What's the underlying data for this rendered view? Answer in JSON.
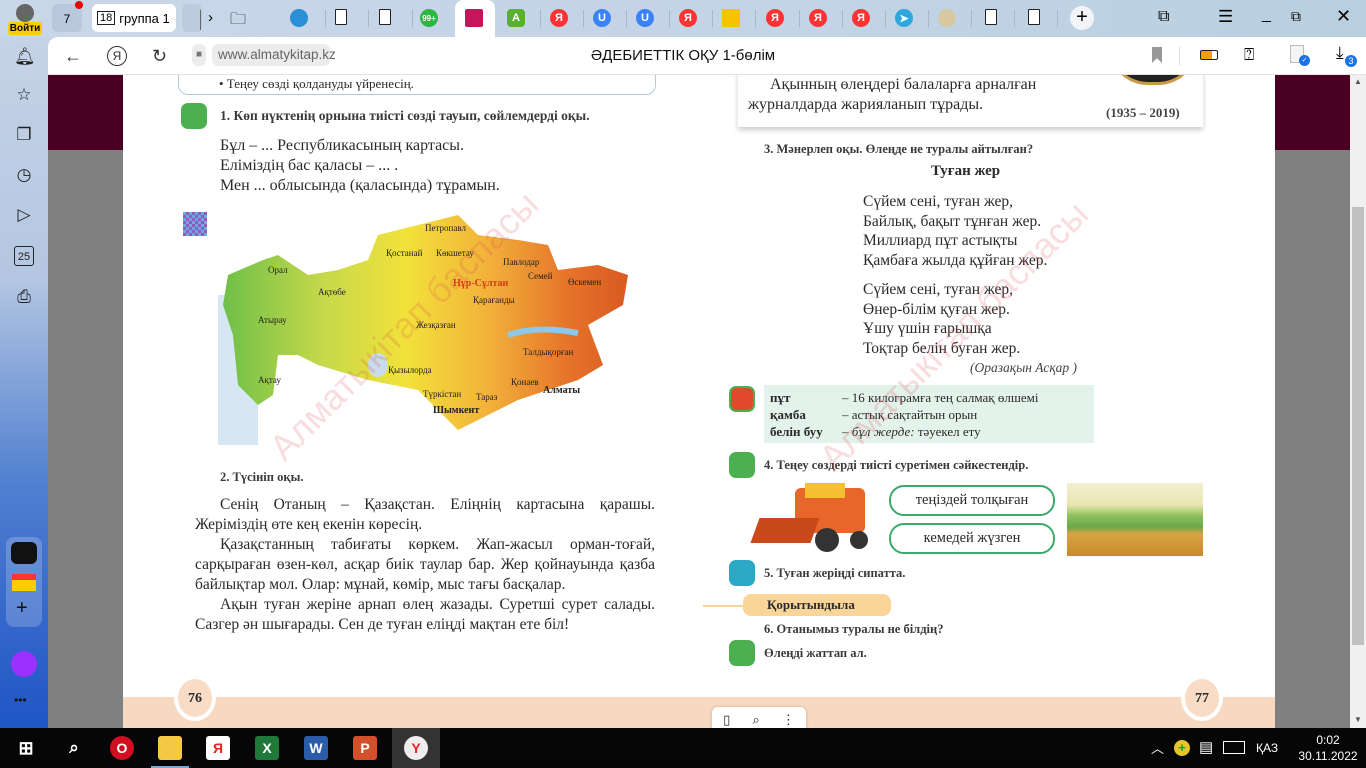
{
  "browser": {
    "profile_label": "Войти",
    "home_count": "7",
    "tab_group": {
      "count": "18",
      "label": "группа 1"
    },
    "whatsapp_badge": "99+",
    "tabs": [
      {
        "icon": "globe-icon"
      },
      {
        "icon": "document-icon"
      },
      {
        "icon": "document-icon"
      },
      {
        "icon": "whatsapp-icon"
      },
      {
        "icon": "book-icon",
        "active": true
      },
      {
        "icon": "green-a-icon",
        "letter": "A"
      },
      {
        "icon": "yandex-icon",
        "letter": "Я"
      },
      {
        "icon": "u-icon",
        "letter": "U"
      },
      {
        "icon": "u-icon",
        "letter": "U"
      },
      {
        "icon": "yandex-icon",
        "letter": "Я"
      },
      {
        "icon": "image-icon"
      },
      {
        "icon": "yandex-icon",
        "letter": "Я"
      },
      {
        "icon": "yandex-icon",
        "letter": "Я"
      },
      {
        "icon": "yandex-icon",
        "letter": "Я"
      },
      {
        "icon": "telegram-icon"
      },
      {
        "icon": "emblem-icon"
      },
      {
        "icon": "document-icon"
      },
      {
        "icon": "document-icon"
      }
    ],
    "url": "www.almatykitap.kz",
    "page_title": "ӘДЕБИЕТТІК ОҚУ 1-бөлім",
    "downloads_badge": "3"
  },
  "left_page": {
    "goal_text": "• Теңеу сөзді қолдануды үйренесің.",
    "task1": "1. Көп нүктенің орнына тиісті сөзді тауып, сөйлемдерді оқы.",
    "task1_lines": [
      "Бұл – ... Республикасының картасы.",
      "Еліміздің бас қаласы – ... .",
      "Мен ... облысында (қаласында) тұрамын."
    ],
    "map_cities": [
      "Петропавл",
      "Қостанай",
      "Көкшетау",
      "Павлодар",
      "Орал",
      "Ақтөбе",
      "Семей",
      "Өскемен",
      "Нұр-Сұлтан",
      "Қарағанды",
      "Атырау",
      "Жезқазған",
      "Талдықорған",
      "Ақтау",
      "Қызылорда",
      "Түркістан",
      "Тараз",
      "Қонаев",
      "Алматы",
      "Шымкент"
    ],
    "task2": "2. Түсініп оқы.",
    "paragraphs": [
      "Сенің Отаның – Қазақстан. Еліңнің картасына қарашы. Жеріміздің өте кең екенін көресің.",
      "Қазақстанның табиғаты көркем. Жап-жасыл орман-тоғай, сарқыраған өзен-көл, асқар биік таулар бар. Жер қойнауында қазба байлықтар мол. Олар: мұнай, көмір, мыс тағы басқалар.",
      "Ақын туған жеріне арнап өлең жазады. Суретші сурет салады. Сазгер ән шығарады. Сен де туған еліңді мақтан ете біл!"
    ],
    "page_number": "76"
  },
  "right_page": {
    "bio_lines": [
      "Ақынның өлеңдері балаларға арналған",
      "журналдарда жарияланып тұрады."
    ],
    "years": "(1935 – 2019)",
    "task3": "3. Мәнерлеп оқы. Өлеңде не туралы айтылған?",
    "poem_title": "Туған жер",
    "stanza1": [
      "Сүйем сені, туған жер,",
      "Байлық, бақыт тұнған жер.",
      "Миллиард пұт астықты",
      "Қамбаға жылда құйған жер."
    ],
    "stanza2": [
      "Сүйем сені, туған жер,",
      "Өнер-білім қуған жер.",
      "Ұшу үшін ғарышқа",
      "Тоқтар белін буған жер."
    ],
    "author": "(Оразақын Асқар )",
    "glossary": [
      {
        "term": "пұт",
        "def": "– 16 килограмға тең салмақ өлшемі"
      },
      {
        "term": "қамба",
        "def": "– астық сақтайтын орын"
      },
      {
        "term": "белін буу",
        "def_italic": "– бұл жерде:",
        "def": " тәуекел ету"
      }
    ],
    "task4": "4. Теңеу сөздерді тиісті суретімен сәйкестендір.",
    "match_options": [
      "теңіздей толқыған",
      "кемедей жүзген"
    ],
    "task5": "5. Туған жеріңді сипатта.",
    "summary_label": "Қорытындыла",
    "task6": "6. Отанымыз туралы не білдің?",
    "homework": "Өлеңді жаттап ал.",
    "page_number": "77"
  },
  "watermark": "Алматыкітап баспасы",
  "taskbar": {
    "apps": [
      "windows-start",
      "search",
      "opera",
      "file-explorer",
      "yandex",
      "excel",
      "word",
      "powerpoint",
      "yandex-browser"
    ],
    "language": "ҚАЗ",
    "time": "0:02",
    "date": "30.11.2022"
  },
  "colors": {
    "maroon": "#4a0022",
    "peach": "#f7d9c1",
    "glossary_bg": "#e3f2ea",
    "accent_green": "#4caf50"
  }
}
